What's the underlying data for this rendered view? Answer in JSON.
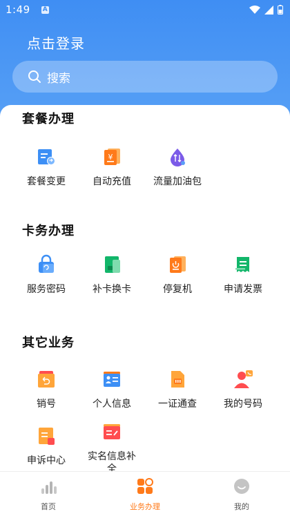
{
  "status_bar": {
    "time": "1:49",
    "notif_letter": "A"
  },
  "header": {
    "login_text": "点击登录",
    "search_placeholder": "搜索"
  },
  "sections": [
    {
      "title": "套餐办理",
      "items": [
        {
          "label": "套餐变更",
          "icon": "plan-change-icon"
        },
        {
          "label": "自动充值",
          "icon": "auto-recharge-icon"
        },
        {
          "label": "流量加油包",
          "icon": "data-booster-icon"
        }
      ]
    },
    {
      "title": "卡务办理",
      "items": [
        {
          "label": "服务密码",
          "icon": "service-password-icon"
        },
        {
          "label": "补卡换卡",
          "icon": "sim-replace-icon"
        },
        {
          "label": "停复机",
          "icon": "suspend-resume-icon"
        },
        {
          "label": "申请发票",
          "icon": "invoice-icon"
        }
      ]
    },
    {
      "title": "其它业务",
      "items": [
        {
          "label": "销号",
          "icon": "cancel-number-icon"
        },
        {
          "label": "个人信息",
          "icon": "personal-info-icon"
        },
        {
          "label": "一证通查",
          "icon": "id-check-icon"
        },
        {
          "label": "我的号码",
          "icon": "my-number-icon"
        },
        {
          "label": "申诉中心",
          "icon": "appeal-center-icon"
        },
        {
          "label": "实名信息补全",
          "icon": "realname-complete-icon"
        }
      ]
    }
  ],
  "tabbar": [
    {
      "label": "首页",
      "icon": "home-chart-icon",
      "active": false
    },
    {
      "label": "业务办理",
      "icon": "business-grid-icon",
      "active": true
    },
    {
      "label": "我的",
      "icon": "profile-face-icon",
      "active": false
    }
  ],
  "colors": {
    "primary_blue": "#3f8ef3",
    "active_orange": "#ff7a1a"
  }
}
